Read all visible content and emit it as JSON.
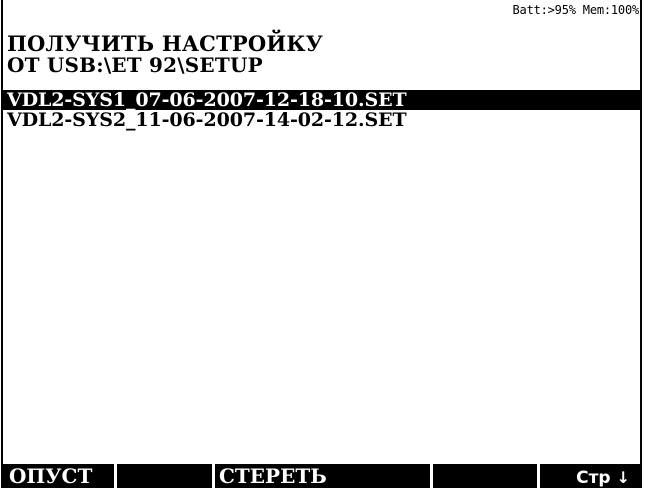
{
  "status": {
    "battery": "Batt:>95%",
    "memory": "Mem:100%"
  },
  "header": {
    "title_line1": "ПОЛУЧИТЬ НАСТРОЙКУ",
    "title_line2": "ОТ USB:\\ET 92\\SETUP"
  },
  "files": [
    {
      "name": "VDL2-SYS1_07-06-2007-12-18-10.SET",
      "selected": true
    },
    {
      "name": "VDL2-SYS2_11-06-2007-14-02-12.SET",
      "selected": false
    }
  ],
  "softkeys": {
    "key1": "ОПУСТ",
    "key2": "",
    "key3": "СТЕРЕТЬ",
    "key4": "",
    "key5": "Стр",
    "key5_icon": "arrow-down-icon"
  },
  "colors": {
    "background": "#ffffff",
    "foreground": "#000000",
    "selection": "#000000"
  }
}
